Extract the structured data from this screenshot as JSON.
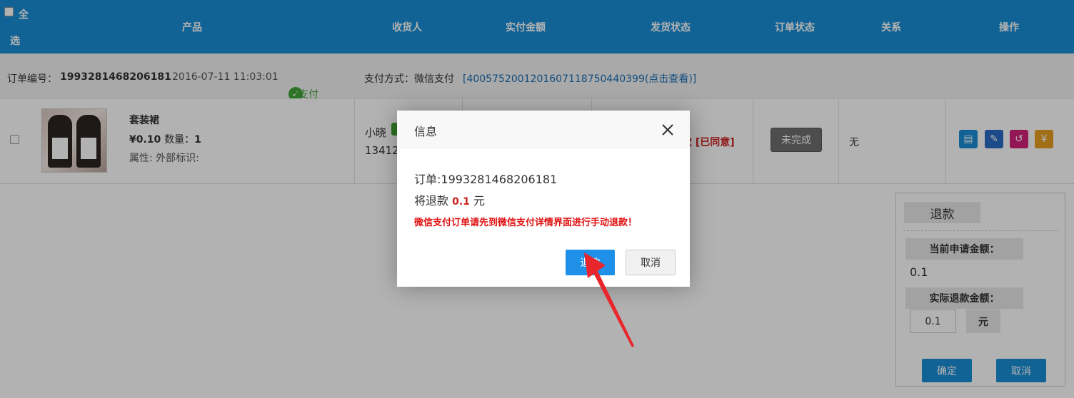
{
  "header": {
    "select_all_1": "全",
    "select_all_2": "选",
    "columns": [
      "产品",
      "收货人",
      "实付金额",
      "发货状态",
      "订单状态",
      "关系",
      "操作"
    ]
  },
  "order": {
    "number_label": "订单编号：",
    "number": "1993281468206181",
    "time": "2016-07-11 11:03:01",
    "paid_status": "已支付",
    "pay_method_label": "支付方式：微信支付",
    "transaction_link": "[4005752001201607118750440399(点击查看)]"
  },
  "product": {
    "name": "套装裙",
    "price": "¥0.10",
    "qty_label": "数量：",
    "qty": "1",
    "attrs": "属性: 外部标识:"
  },
  "receiver": {
    "name": "小晓",
    "phone": "13412"
  },
  "refund_status_tail": "款 [已同意]",
  "order_status_button": "未完成",
  "relation": "无",
  "ops": [
    "note-icon",
    "edit-icon",
    "refund-icon",
    "yuan-edit-icon"
  ],
  "refund_panel": {
    "title": "退款",
    "current_label": "当前申请金额：",
    "current_value": "0.1",
    "actual_label": "实际退款金额：",
    "actual_value": "0.1",
    "unit": "元",
    "confirm": "确定",
    "cancel": "取消"
  },
  "dialog": {
    "title": "信息",
    "order_line": "订单:1993281468206181",
    "refund_prefix": "将退款 ",
    "refund_amount": "0.1",
    "refund_suffix": " 元",
    "warning": "微信支付订单请先到微信支付详情界面进行手动退款！",
    "ok": "退款",
    "cancel": "取消"
  },
  "colors": {
    "header_bg": "#1a8fd6",
    "primary_button": "#1e90e8",
    "warning": "#e01010",
    "paid_green": "#3fa535",
    "annotation_arrow": "#e8262c"
  }
}
